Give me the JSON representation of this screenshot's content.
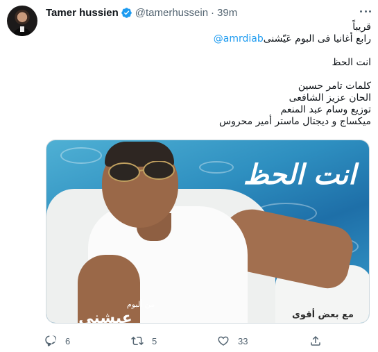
{
  "tweet": {
    "display_name": "Tamer hussien",
    "handle": "@tamerhussein",
    "separator": "·",
    "time": "39m",
    "lines": [
      "قريباً",
      "رابع أغانيا فى البوم عَيّشنى",
      "انت الحظ",
      "كلمات  تامر حسين",
      "الحان  عزيز الشافعى",
      "توزيع  وسام عبد المنعم",
      "ميكساج  و ديجتال ماستر أمير محروس"
    ],
    "mention": "@amrdiab"
  },
  "media": {
    "album_title": "انت الحظ",
    "from_album": "من ألبوم",
    "album_logo": "عيشني",
    "brand": "مع بعض أقوى"
  },
  "actions": {
    "reply_count": "6",
    "retweet_count": "5",
    "like_count": "33"
  },
  "icons": {
    "verified": "verified-badge-icon",
    "more": "more-icon",
    "reply": "reply-icon",
    "retweet": "retweet-icon",
    "like": "heart-icon",
    "share": "share-icon"
  },
  "colors": {
    "accent": "#1d9bf0",
    "secondary_text": "#536471",
    "primary_text": "#0f1419"
  }
}
